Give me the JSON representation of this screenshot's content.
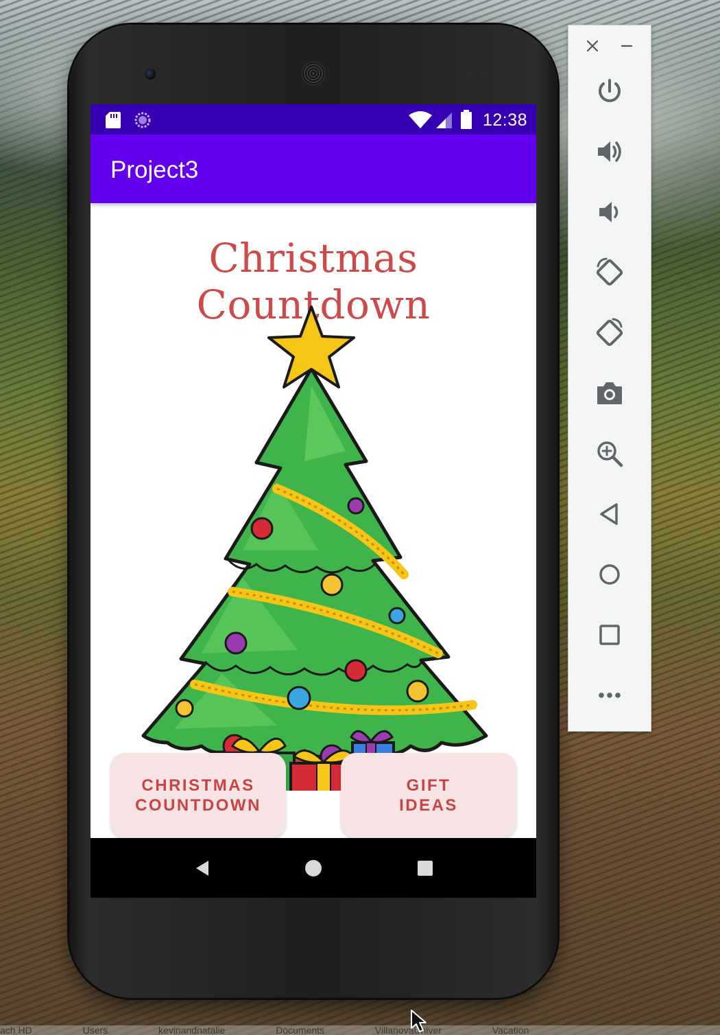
{
  "status_bar": {
    "time": "12:38",
    "icons": [
      "sd-card-icon",
      "sync-icon",
      "wifi-icon",
      "cell-signal-icon",
      "battery-icon"
    ]
  },
  "app_bar": {
    "title": "Project3"
  },
  "main": {
    "heading": "Christmas Countdown",
    "image": "christmas-tree-illustration",
    "buttons": {
      "countdown_label": "CHRISTMAS\nCOUNTDOWN",
      "gift_label": "GIFT\nIDEAS"
    }
  },
  "nav_bar": {
    "icons": [
      "back-triangle-icon",
      "home-circle-icon",
      "recents-square-icon"
    ]
  },
  "emulator_panel": {
    "controls": [
      "close-icon",
      "minimize-icon",
      "power-icon",
      "volume-up-icon",
      "volume-down-icon",
      "rotate-left-icon",
      "rotate-right-icon",
      "camera-icon",
      "zoom-icon",
      "back-icon",
      "home-icon",
      "overview-icon",
      "more-icon"
    ]
  },
  "bottom_strip": {
    "items": [
      "ach HD",
      "Users",
      "kevinandnatalie",
      "Documents",
      "VillanovaUniver",
      "Vacation"
    ]
  },
  "colors": {
    "status_bar": "#3700b3",
    "app_bar": "#6200ee",
    "heading": "#cc4a4a",
    "button_bg": "#f6e3e3",
    "button_text": "#c84444"
  }
}
